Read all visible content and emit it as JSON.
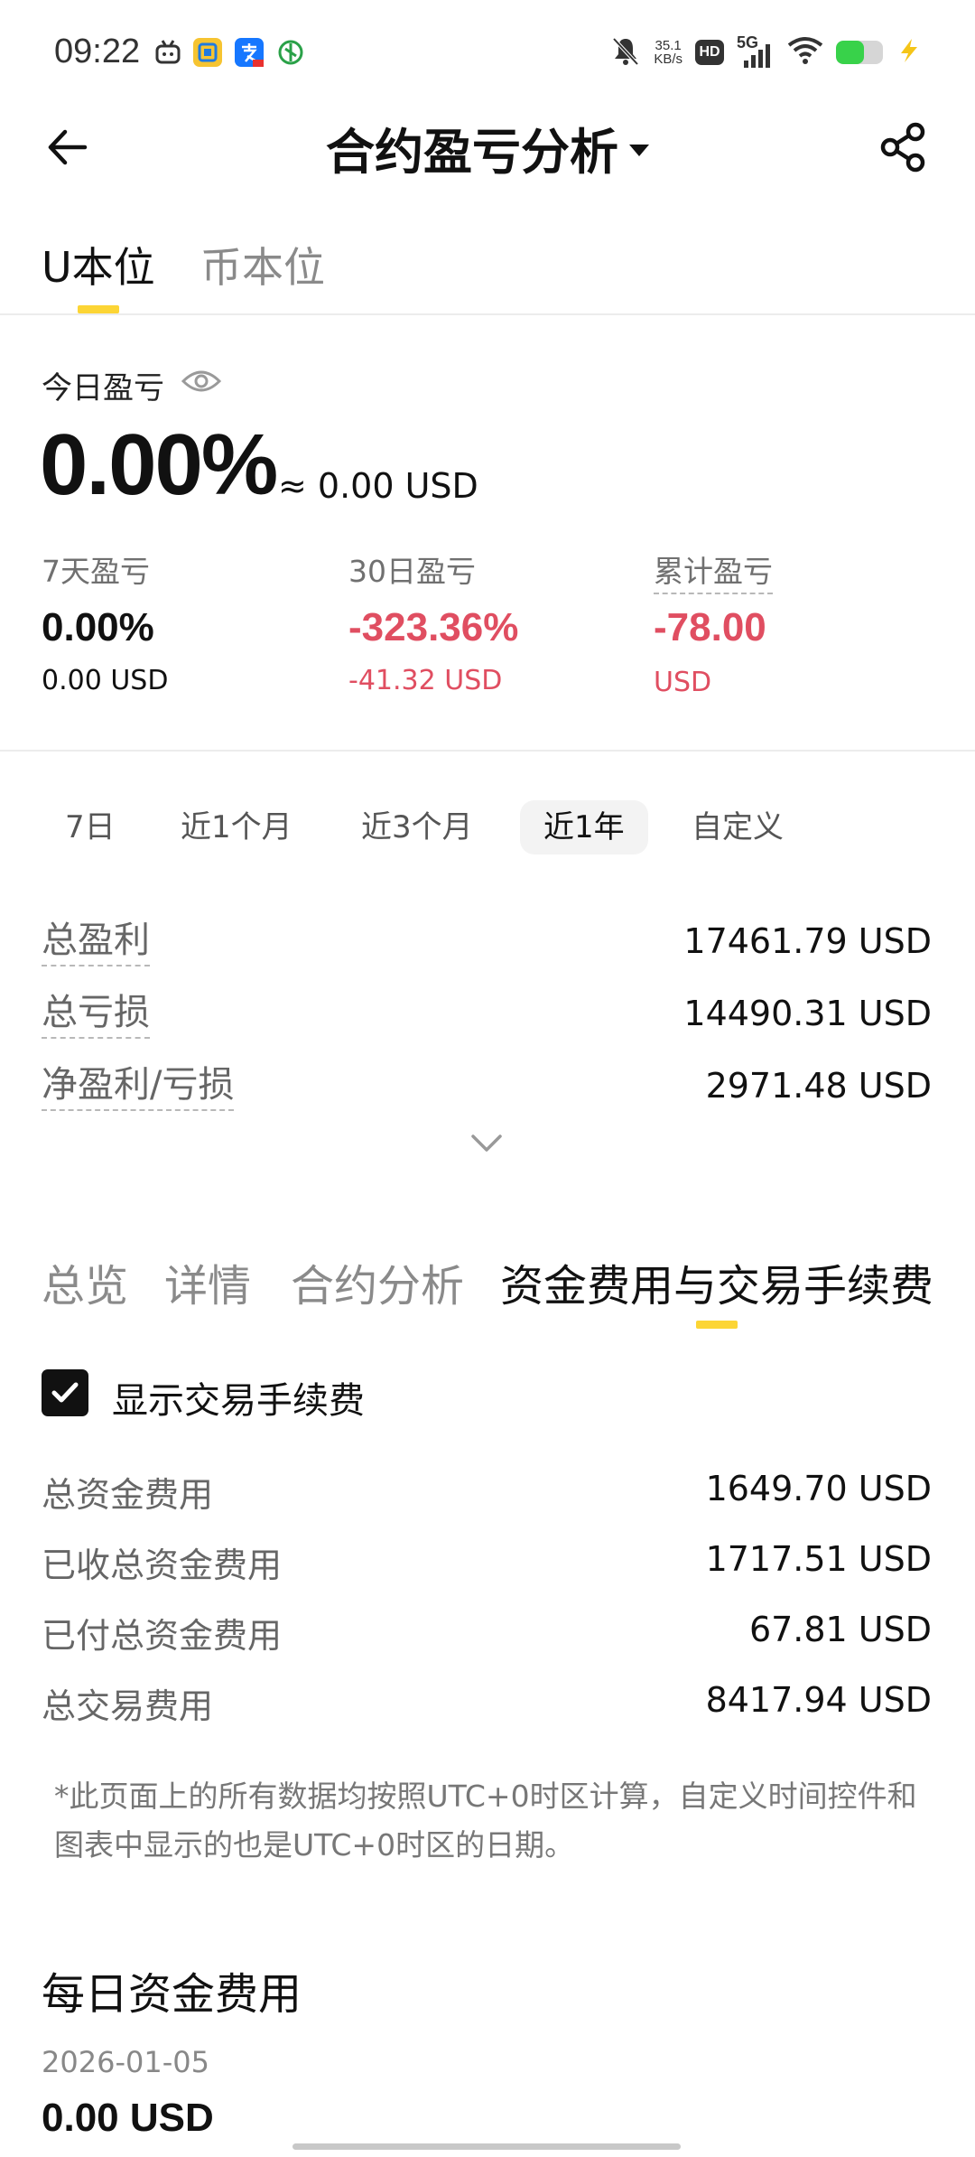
{
  "status_bar": {
    "time": "09:22",
    "speed_value": "35.1",
    "speed_unit": "KB/s",
    "hd": "HD",
    "network": "5G",
    "battery_level": 0.6
  },
  "header": {
    "title": "合约盈亏分析"
  },
  "unit_tabs": [
    "U本位",
    "币本位"
  ],
  "today": {
    "label": "今日盈亏",
    "pct": "0.00%",
    "approx": "≈ 0.00 USD"
  },
  "stats": [
    {
      "label": "7天盈亏",
      "value": "0.00%",
      "sub": "0.00 USD"
    },
    {
      "label": "30日盈亏",
      "value": "-323.36%",
      "sub": "-41.32 USD"
    },
    {
      "label": "累计盈亏",
      "value": "-78.00",
      "sub": "USD"
    }
  ],
  "range_tabs": [
    "7日",
    "近1个月",
    "近3个月",
    "近1年",
    "自定义"
  ],
  "range_active": "近1年",
  "summary": [
    {
      "label": "总盈利",
      "value": "17461.79 USD"
    },
    {
      "label": "总亏损",
      "value": "14490.31 USD"
    },
    {
      "label": "净盈利/亏损",
      "value": "2971.48 USD"
    }
  ],
  "section_tabs": [
    "总览",
    "详情",
    "合约分析",
    "资金费用与交易手续费"
  ],
  "checkbox_label": "显示交易手续费",
  "fees": [
    {
      "label": "总资金费用",
      "value": "1649.70 USD"
    },
    {
      "label": "已收总资金费用",
      "value": "1717.51 USD"
    },
    {
      "label": "已付总资金费用",
      "value": "67.81 USD"
    },
    {
      "label": "总交易费用",
      "value": "8417.94 USD"
    }
  ],
  "note": "*此页面上的所有数据均按照UTC+0时区计算，自定义时间控件和图表中显示的也是UTC+0时区的日期。",
  "daily": {
    "title": "每日资金费用",
    "date": "2026-01-05",
    "value": "0.00 USD"
  },
  "colors": {
    "accent": "#fcd535",
    "negative": "#e04e61"
  }
}
